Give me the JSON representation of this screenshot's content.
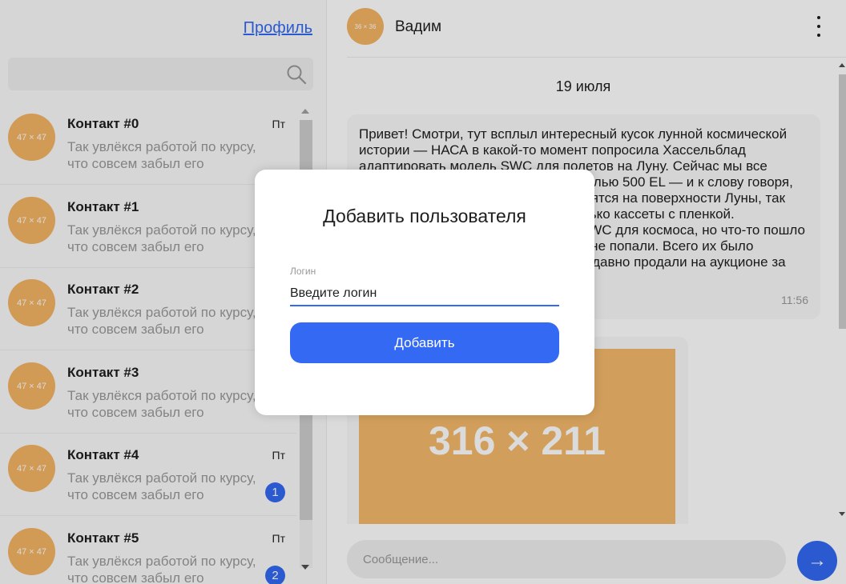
{
  "sidebar": {
    "profile_link": "Профиль",
    "search_icon": "search-icon",
    "contacts": [
      {
        "avatar": "47 × 47",
        "name": "Контакт #0",
        "time": "Пт",
        "preview": "Так увлёкся работой по курсу, что совсем забыл его",
        "unread": ""
      },
      {
        "avatar": "47 × 47",
        "name": "Контакт #1",
        "time": "",
        "preview": "Так увлёкся работой по курсу, что совсем забыл его",
        "unread": ""
      },
      {
        "avatar": "47 × 47",
        "name": "Контакт #2",
        "time": "",
        "preview": "Так увлёкся работой по курсу, что совсем забыл его",
        "unread": ""
      },
      {
        "avatar": "47 × 47",
        "name": "Контакт #3",
        "time": "",
        "preview": "Так увлёкся работой по курсу, что совсем забыл его",
        "unread": ""
      },
      {
        "avatar": "47 × 47",
        "name": "Контакт #4",
        "time": "Пт",
        "preview": "Так увлёкся работой по курсу, что совсем забыл его",
        "unread": "1"
      },
      {
        "avatar": "47 × 47",
        "name": "Контакт #5",
        "time": "Пт",
        "preview": "Так увлёкся работой по курсу, что совсем забыл его",
        "unread": "2"
      }
    ]
  },
  "chat": {
    "avatar": "36 × 36",
    "name": "Вадим",
    "menu_icon": "kebab-menu-icon",
    "date": "19 июля",
    "message": {
      "text": "Привет! Смотри, тут всплыл интересный кусок лунной космической истории — НАСА в какой-то момент попросила Хассельблад адаптировать модель SWC для полетов на Луну. Сейчас мы все знаем что астронавты летали с моделью 500 EL — и к слову говоря, все тушки этих камер все еще находятся на поверхности Луны, так как астронавты с собой забрали только кассеты с пленкой. Хассельблад в итоге адаптировал SWC для космоса, но что-то пошло не так и на ракету они так никогда и не попали. Всего их было произведено 25 штук, одну из них недавно продали на аукционе за 45000 евро.",
      "time": "11:56"
    },
    "image_placeholder": "316 × 211",
    "composer_placeholder": "Сообщение...",
    "send_icon": "arrow-right-icon",
    "send_glyph": "→"
  },
  "modal": {
    "title": "Добавить пользователя",
    "field_label": "Логин",
    "field_placeholder": "Введите логин",
    "submit_label": "Добавить"
  },
  "colors": {
    "accent": "#3369f3",
    "avatar": "#f4b464",
    "muted_text": "#999999",
    "overlay": "rgba(0,0,0,0.14)"
  }
}
